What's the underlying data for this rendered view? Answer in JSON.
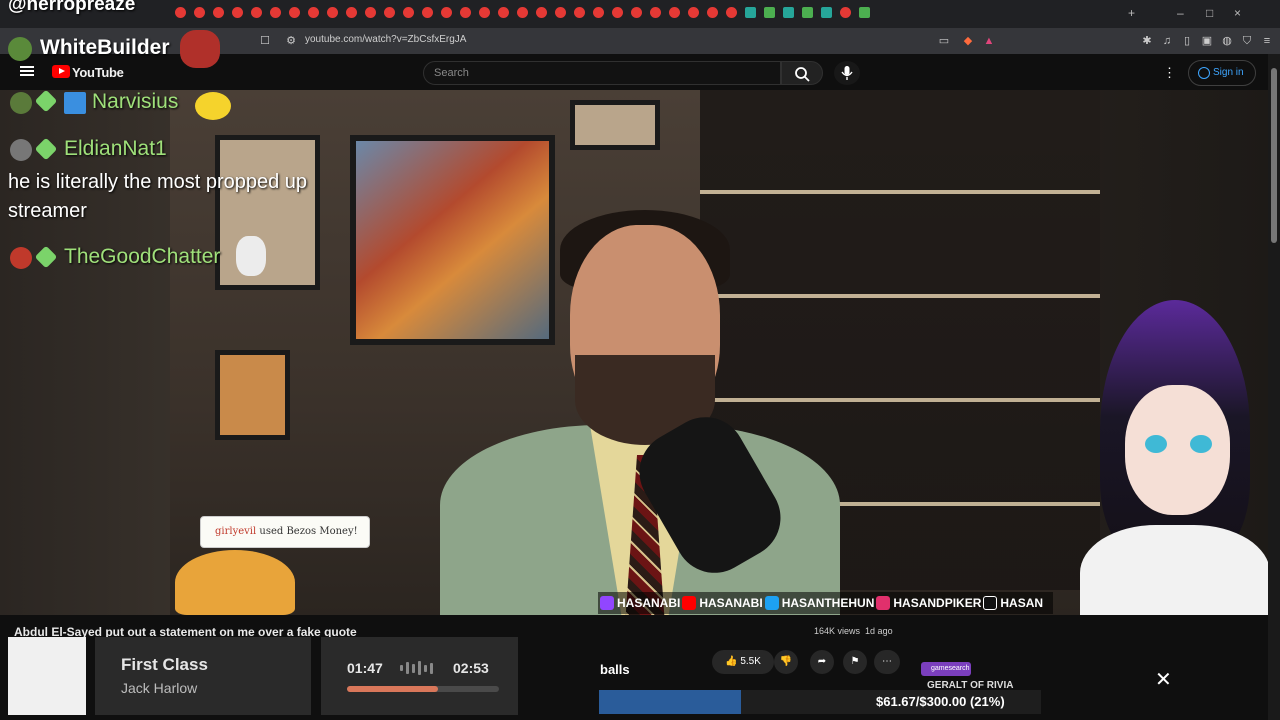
{
  "overlay": {
    "handle": "@herropreaze",
    "streamer_name": "WhiteBuilder"
  },
  "browser": {
    "url": "youtube.com/watch?v=ZbCsfxErgJA"
  },
  "youtube": {
    "logo_text": "YouTube",
    "search_placeholder": "Search",
    "signin_label": "Sign in"
  },
  "chat": {
    "messages": [
      {
        "name": "Narvisius"
      },
      {
        "name": "EldianNat1",
        "text": "he is literally the most propped up streamer"
      },
      {
        "name": "TheGoodChatter"
      }
    ]
  },
  "alert": {
    "user": "girlyevil",
    "action": "used Bezos Money!"
  },
  "socials": [
    "HASANABI",
    "HASANABI",
    "HASANTHEHUN",
    "HASANDPIKER",
    "HASAN"
  ],
  "video": {
    "title": "Abdul El-Sayed put out a statement on me over a fake quote",
    "views": "164K views",
    "age": "1d ago",
    "likes": "5.5K"
  },
  "now_playing": {
    "song": "First Class",
    "artist": "Jack Harlow",
    "current_time": "01:47",
    "total_time": "02:53",
    "progress": 0.6
  },
  "stream_overlay": {
    "caption": "balls",
    "goal_text": "$61.67/$300.00 (21%)",
    "sponsor": "gamesearch",
    "game_label": "GERALT OF RIVIA"
  },
  "colors": {
    "chat_name": "#9fe07a",
    "youtube_red": "#ff0000",
    "signin_blue": "#3ea6ff"
  }
}
